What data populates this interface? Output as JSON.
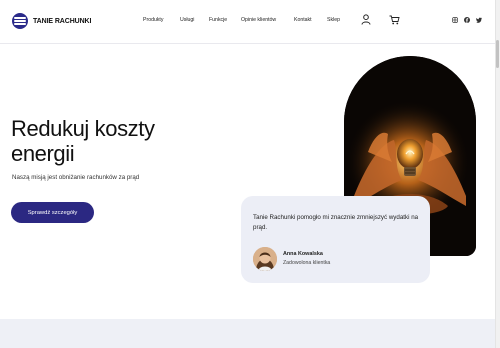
{
  "brand": {
    "name": "TANIE RACHUNKI"
  },
  "nav": {
    "items": [
      "Produkty",
      "Usługi",
      "Funkcje",
      "Opinie klientów",
      "Kontakt",
      "Sklep"
    ]
  },
  "header_icons": {
    "user": "user-icon",
    "cart": "cart-icon",
    "social": [
      "instagram-icon",
      "facebook-icon",
      "twitter-icon"
    ]
  },
  "hero": {
    "title": "Redukuj koszty energii",
    "subtitle": "Naszą misją jest obniżanie rachunków za prąd",
    "cta_label": "Sprawdź szczegóły"
  },
  "testimonial": {
    "quote": "Tanie Rachunki pomogło mi znacznie zmniejszyć wydatki na prąd.",
    "name": "Anna Kowalska",
    "role": "Zadowolona klientka"
  },
  "colors": {
    "accent": "#2b2882",
    "testimonial_bg": "#eceef6",
    "band_bg": "#eef0f6"
  }
}
